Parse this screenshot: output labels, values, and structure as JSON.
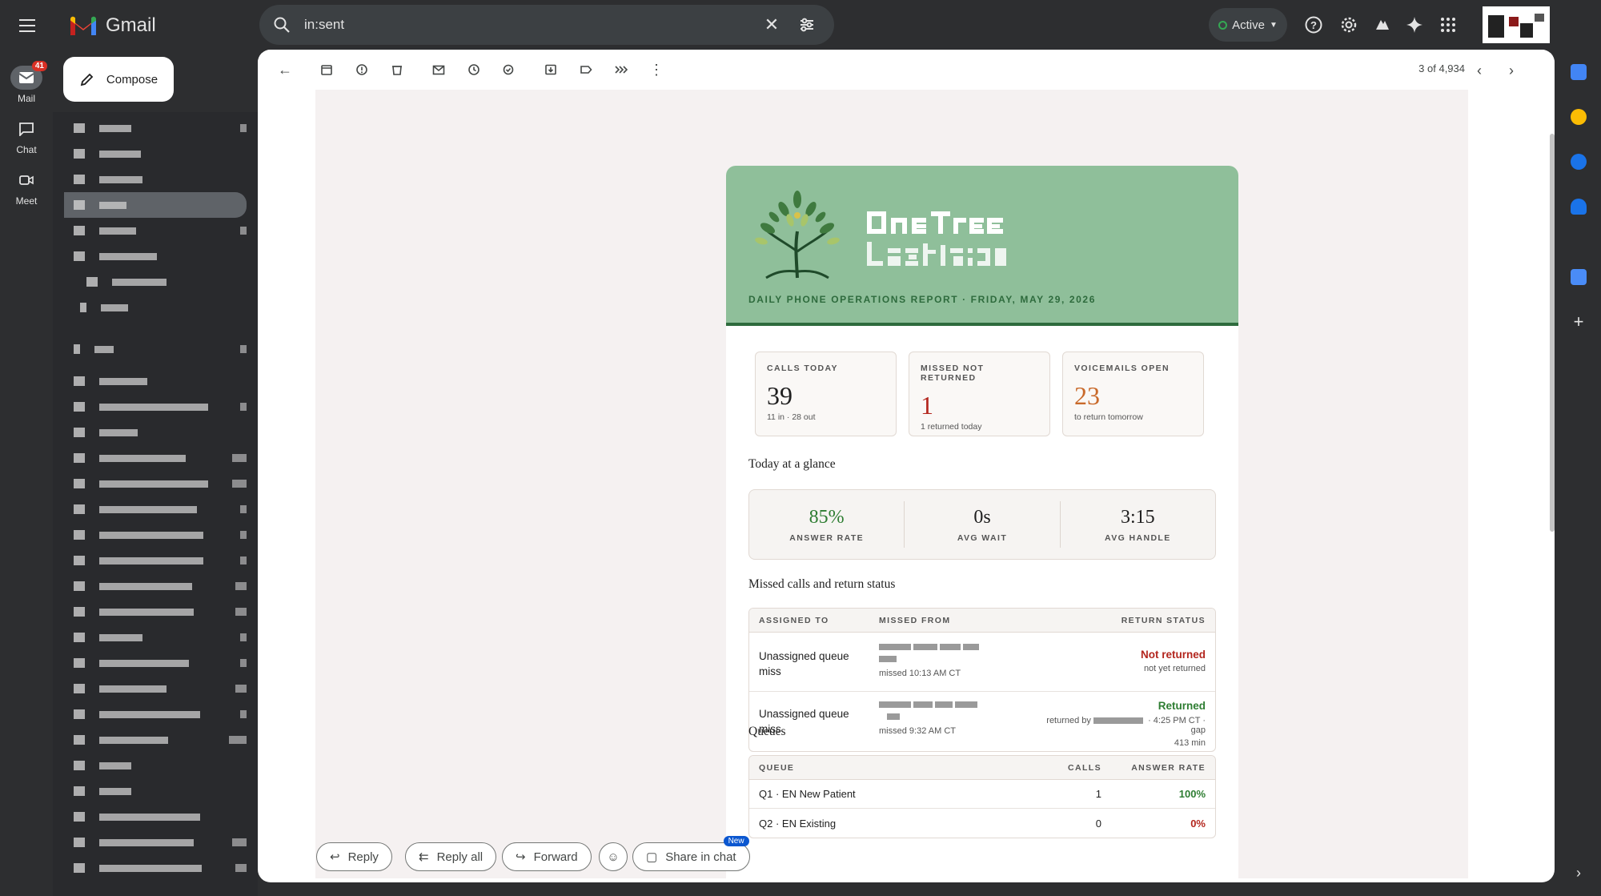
{
  "app": {
    "name": "Gmail"
  },
  "search": {
    "value": "in:sent",
    "clear_label": "✕",
    "options_label": "☷"
  },
  "status": {
    "label": "Active"
  },
  "rail": {
    "mail": {
      "label": "Mail",
      "badge": "41"
    },
    "chat": {
      "label": "Chat"
    },
    "meet": {
      "label": "Meet"
    }
  },
  "compose": {
    "label": "Compose"
  },
  "toolbar": {
    "pager": "3 of 4,934"
  },
  "email": {
    "report_title": "DAILY PHONE OPERATIONS REPORT · FRIDAY, MAY 29, 2026",
    "stats": [
      {
        "label": "CALLS TODAY",
        "value": "39",
        "sub": "11 in · 28 out",
        "color": "#1f1f1f"
      },
      {
        "label": "MISSED NOT RETURNED",
        "value": "1",
        "sub": "1 returned today",
        "color": "#b3261e"
      },
      {
        "label": "VOICEMAILS OPEN",
        "value": "23",
        "sub": "to return tomorrow",
        "color": "#c96a2b"
      }
    ],
    "glance": {
      "title": "Today at a glance",
      "cells": [
        {
          "value": "85%",
          "label": "ANSWER RATE",
          "color": "#2e7d32"
        },
        {
          "value": "0s",
          "label": "AVG WAIT",
          "color": "#1f1f1f"
        },
        {
          "value": "3:15",
          "label": "AVG HANDLE",
          "color": "#1f1f1f"
        }
      ]
    },
    "missed": {
      "title": "Missed calls and return status",
      "headers": [
        "ASSIGNED TO",
        "MISSED FROM",
        "RETURN STATUS"
      ],
      "rows": [
        {
          "assigned": "Unassigned queue miss",
          "missed_time": "missed 10:13 AM CT",
          "status": "Not returned",
          "detail": "not yet returned"
        },
        {
          "assigned": "Unassigned queue miss",
          "missed_time": "missed 9:32 AM CT",
          "status": "Returned",
          "detail_prefix": "returned by",
          "detail_suffix": "· 4:25 PM CT · gap",
          "detail_gap": "413 min"
        }
      ]
    },
    "queues": {
      "title": "Queues",
      "headers": [
        "QUEUE",
        "CALLS",
        "ANSWER RATE"
      ],
      "rows": [
        {
          "queue": "Q1 · EN New Patient",
          "calls": "1",
          "rate": "100%"
        },
        {
          "queue": "Q2 · EN Existing",
          "calls": "0",
          "rate": "0%"
        }
      ]
    }
  },
  "reply_bar": {
    "reply": "Reply",
    "reply_all": "Reply all",
    "forward": "Forward",
    "share": "Share in chat",
    "new_badge": "New"
  },
  "colors": {
    "accent_green": "#2e6b3d",
    "banner": "#8fbf9a",
    "red": "#b3261e",
    "green": "#2e7d32"
  }
}
